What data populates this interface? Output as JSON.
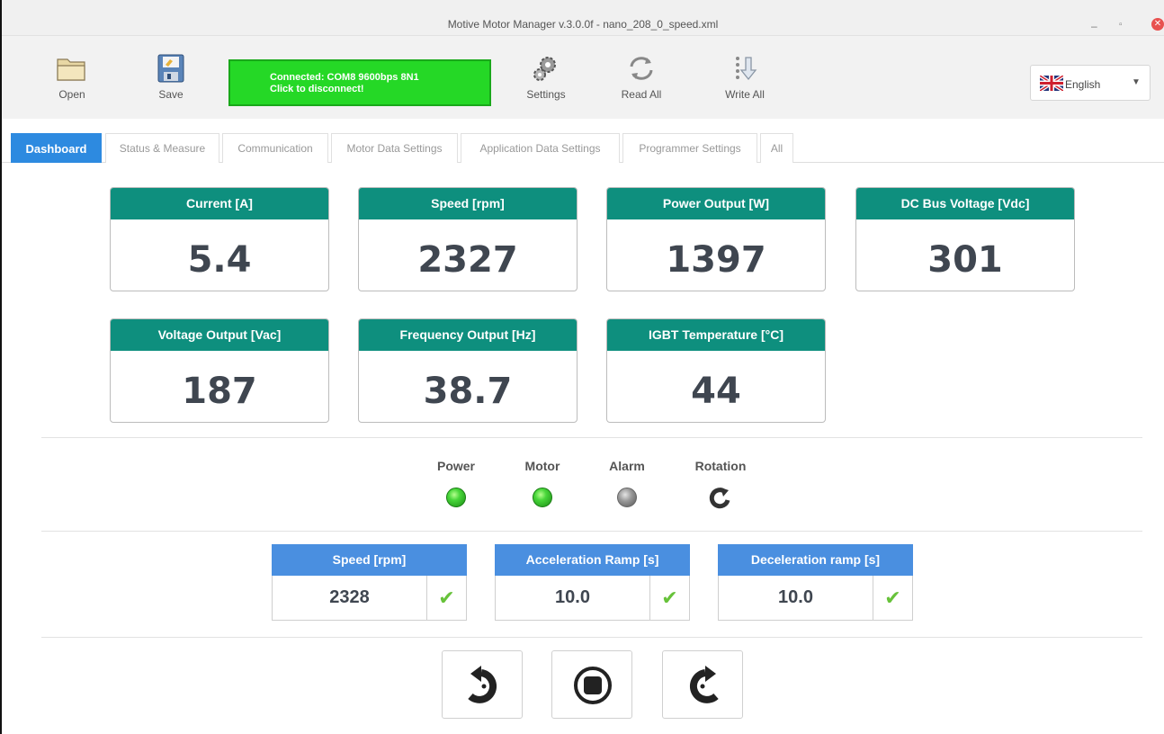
{
  "window": {
    "title": "Motive Motor Manager v.3.0.0f - nano_208_0_speed.xml",
    "controls": {
      "minimize": "–",
      "maximize": "▫",
      "close": "✕"
    }
  },
  "toolbar": {
    "open_label": "Open",
    "save_label": "Save",
    "connection": {
      "line1": "Connected: COM8 9600bps 8N1",
      "line2": "Click to disconnect!",
      "color": "#25d826"
    },
    "settings_label": "Settings",
    "read_all_label": "Read All",
    "write_all_label": "Write All",
    "language": {
      "selected": "English",
      "flag_icon": "uk-flag-icon"
    }
  },
  "tabs": [
    {
      "label": "Dashboard",
      "active": true
    },
    {
      "label": "Status & Measure",
      "active": false
    },
    {
      "label": "Communication",
      "active": false
    },
    {
      "label": "Motor Data Settings",
      "active": false
    },
    {
      "label": "Application Data Settings",
      "active": false
    },
    {
      "label": "Programmer Settings",
      "active": false
    },
    {
      "label": "All",
      "active": false
    }
  ],
  "metrics": [
    {
      "label": "Current [A]",
      "value": "5.4"
    },
    {
      "label": "Speed [rpm]",
      "value": "2327"
    },
    {
      "label": "Power Output [W]",
      "value": "1397"
    },
    {
      "label": "DC Bus Voltage [Vdc]",
      "value": "301"
    },
    {
      "label": "Voltage Output [Vac]",
      "value": "187"
    },
    {
      "label": "Frequency Output [Hz]",
      "value": "38.7"
    },
    {
      "label": "IGBT Temperature [°C]",
      "value": "44"
    }
  ],
  "indicators": [
    {
      "label": "Power",
      "state": "on",
      "color": "green"
    },
    {
      "label": "Motor",
      "state": "on",
      "color": "green"
    },
    {
      "label": "Alarm",
      "state": "off",
      "color": "gray"
    },
    {
      "label": "Rotation",
      "icon": "rotate-counterclockwise-icon"
    }
  ],
  "parameters": [
    {
      "label": "Speed [rpm]",
      "value": "2328"
    },
    {
      "label": "Acceleration Ramp [s]",
      "value": "10.0"
    },
    {
      "label": "Deceleration ramp [s]",
      "value": "10.0"
    }
  ],
  "controls": [
    {
      "name": "rotate-reverse",
      "icon": "rotate-left-icon"
    },
    {
      "name": "stop",
      "icon": "stop-icon"
    },
    {
      "name": "rotate-forward",
      "icon": "rotate-right-icon"
    }
  ],
  "colors": {
    "metric_header": "#0e8f7e",
    "param_header": "#4a8fe0",
    "tab_active": "#2d8ae0",
    "check": "#67c23a"
  }
}
